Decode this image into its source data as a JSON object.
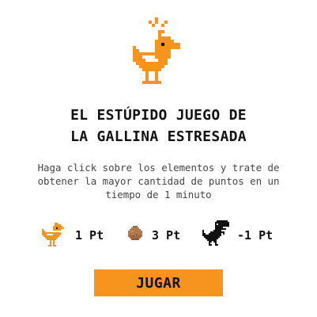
{
  "title": {
    "line1": "EL ESTÚPIDO JUEGO DE",
    "line2": "LA GALLINA ESTRESADA"
  },
  "description": {
    "line1": "Haga click sobre los elementos y trate de",
    "line2": "obtener la mayor cantidad de puntos en un",
    "line3": "tiempo de 1 minuto"
  },
  "points": [
    {
      "icon": "hen-icon",
      "label": "1 Pt"
    },
    {
      "icon": "egg-icon",
      "label": "3 Pt"
    },
    {
      "icon": "dinosaur-icon",
      "label": "-1 Pt"
    }
  ],
  "play_button": {
    "label": "JUGAR"
  },
  "colors": {
    "accent": "#f7941d",
    "text": "#111111",
    "muted": "#444444",
    "egg": "#b07a4f"
  }
}
